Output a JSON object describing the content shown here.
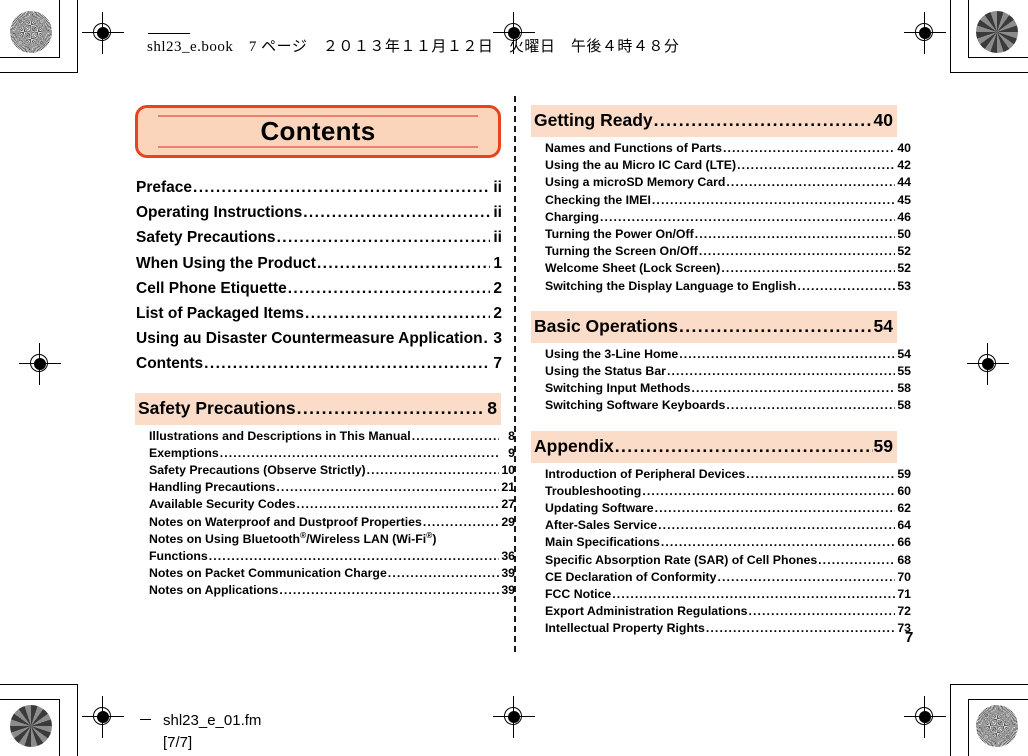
{
  "slug": {
    "text": "shl23_e.book　7 ページ　２０１３年１１月１２日　火曜日　午後４時４８分"
  },
  "header": {
    "title": "Contents"
  },
  "colors": {
    "plate_border": "#e8431e",
    "plate_fill": "#fad5bc",
    "plate_rule": "#e8836b",
    "band_fill": "#fbdcc8"
  },
  "left_column": {
    "top_entries": [
      {
        "label": "Preface",
        "page": "ii"
      },
      {
        "label": "Operating Instructions",
        "page": "ii"
      },
      {
        "label": "Safety Precautions",
        "page": "ii"
      },
      {
        "label": "When Using the Product",
        "page": "1"
      },
      {
        "label": "Cell Phone Etiquette",
        "page": "2"
      },
      {
        "label": "List of Packaged Items",
        "page": "2"
      },
      {
        "label": "Using au Disaster Countermeasure Application",
        "page": "3"
      },
      {
        "label": "Contents",
        "page": "7"
      }
    ],
    "section": {
      "title": "Safety Precautions",
      "page": "8",
      "entries": [
        {
          "label": "Illustrations and Descriptions in This Manual",
          "page": "8"
        },
        {
          "label": "Exemptions",
          "page": "9"
        },
        {
          "label": "Safety Precautions (Observe Strictly)",
          "page": "10"
        },
        {
          "label": "Handling Precautions",
          "page": "21"
        },
        {
          "label": "Available Security Codes",
          "page": "27"
        },
        {
          "label": "Notes on Waterproof and Dustproof Properties",
          "page": "29"
        },
        {
          "label": "Notes on Using Bluetooth®/Wireless LAN (Wi-Fi®)",
          "label_cont": "Functions",
          "page": "36",
          "wrapped": true
        },
        {
          "label": "Notes on Packet Communication Charge",
          "page": "39"
        },
        {
          "label": "Notes on Applications",
          "page": "39"
        }
      ]
    }
  },
  "right_column": {
    "sections": [
      {
        "title": "Getting Ready",
        "page": "40",
        "entries": [
          {
            "label": "Names and Functions of Parts",
            "page": "40"
          },
          {
            "label": "Using the au Micro IC Card (LTE)",
            "page": "42"
          },
          {
            "label": "Using a microSD Memory Card",
            "page": "44"
          },
          {
            "label": "Checking the IMEI",
            "page": "45"
          },
          {
            "label": "Charging",
            "page": "46"
          },
          {
            "label": "Turning the Power On/Off",
            "page": "50"
          },
          {
            "label": "Turning the Screen On/Off",
            "page": "52"
          },
          {
            "label": "Welcome Sheet (Lock Screen)",
            "page": "52"
          },
          {
            "label": "Switching the Display Language to English",
            "page": "53"
          }
        ]
      },
      {
        "title": "Basic Operations",
        "page": "54",
        "entries": [
          {
            "label": "Using the 3-Line Home",
            "page": "54"
          },
          {
            "label": "Using the Status Bar",
            "page": "55"
          },
          {
            "label": "Switching Input Methods",
            "page": "58"
          },
          {
            "label": "Switching Software Keyboards",
            "page": "58"
          }
        ]
      },
      {
        "title": "Appendix",
        "page": "59",
        "entries": [
          {
            "label": "Introduction of Peripheral Devices",
            "page": "59"
          },
          {
            "label": "Troubleshooting",
            "page": "60"
          },
          {
            "label": "Updating Software",
            "page": "62"
          },
          {
            "label": "After-Sales Service",
            "page": "64"
          },
          {
            "label": "Main Specifications",
            "page": "66"
          },
          {
            "label": "Specific Absorption Rate (SAR) of Cell Phones",
            "page": "68"
          },
          {
            "label": "CE Declaration of Conformity",
            "page": "70"
          },
          {
            "label": "FCC Notice",
            "page": "71"
          },
          {
            "label": "Export Administration Regulations",
            "page": "72"
          },
          {
            "label": "Intellectual Property Rights",
            "page": "73"
          }
        ]
      }
    ]
  },
  "footer": {
    "file_name": "shl23_e_01.fm",
    "page_range": "[7/7]",
    "page_number": "7"
  }
}
